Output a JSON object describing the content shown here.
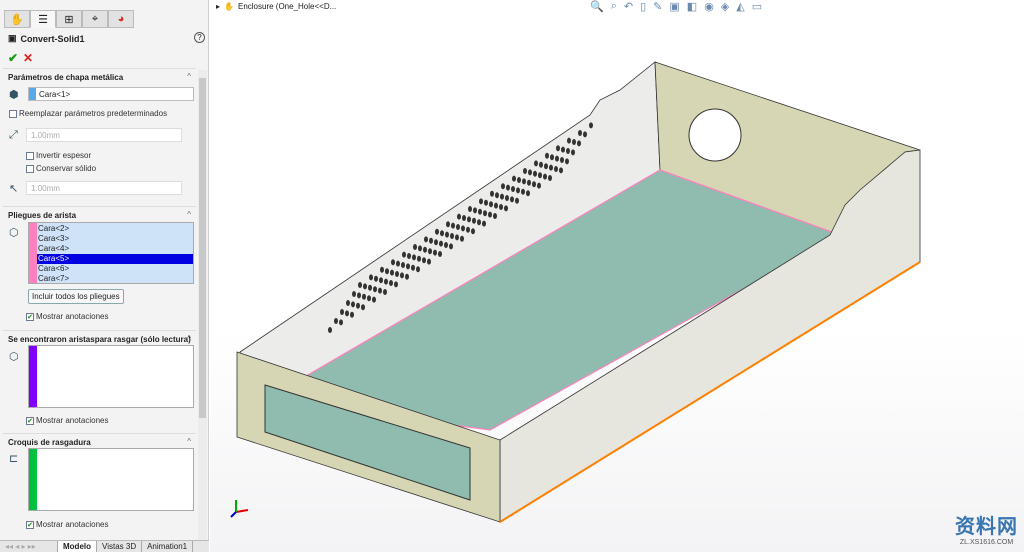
{
  "panel": {
    "tabs": [
      {
        "icon": "feature-manager-icon"
      },
      {
        "icon": "property-manager-icon"
      },
      {
        "icon": "configuration-manager-icon"
      },
      {
        "icon": "dimxpert-icon"
      },
      {
        "icon": "display-manager-icon"
      }
    ],
    "title": "Convert-Solid1",
    "help": "?",
    "ok": "✔",
    "cancel": "✕",
    "sections": {
      "params": {
        "title": "Parámetros de chapa metálica",
        "face": "Cara<1>",
        "override": "Reemplazar parámetros predeterminados",
        "thickness": "1.00mm",
        "reverse": "Invertir espesor",
        "keep": "Conservar sólido",
        "radius": "1.00mm"
      },
      "bends": {
        "title": "Pliegues de arista",
        "items": [
          "Cara<2>",
          "Cara<3>",
          "Cara<4>",
          "Cara<5>",
          "Cara<6>",
          "Cara<7>"
        ],
        "selected_index": 3,
        "include_all": "Incluir todos los pliegues",
        "show": "Mostrar anotaciones"
      },
      "rip_edges": {
        "title": "Se encontraron aristaspara rasgar (sólo lectura)",
        "show": "Mostrar anotaciones"
      },
      "rip_sketch": {
        "title": "Croquis de rasgadura",
        "show": "Mostrar anotaciones"
      }
    },
    "bottom_tabs": [
      "Modelo",
      "Vistas 3D",
      "Animation1"
    ],
    "active_tab": "Modelo"
  },
  "viewport": {
    "tree_label": "Enclosure  (One_Hole<<D...",
    "watermark": "资料网",
    "watermark_url": "ZL.XS1616.COM"
  },
  "colors": {
    "bend_bar": "#ff80c0",
    "rip_bar": "#8000ff",
    "sketch_bar": "#00c040",
    "floor": "#8fbcae",
    "wall": "#d6d6b4"
  }
}
